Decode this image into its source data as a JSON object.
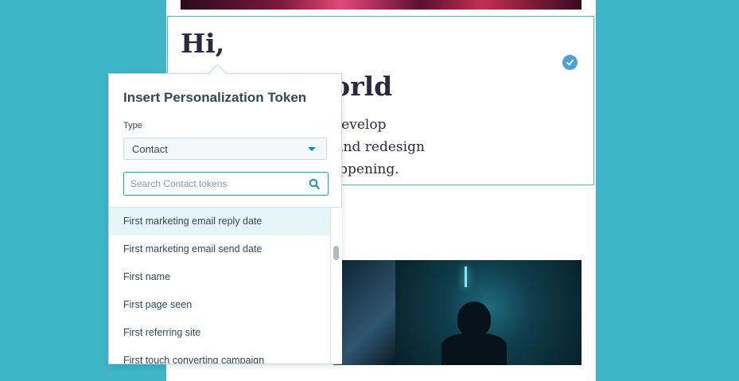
{
  "email": {
    "greeting": "Hi,",
    "headline": "over the world",
    "body_lines": [
      "ed that, once humans develop",
      "rill take off on its own and redesign",
      "g rate. And now, it’s happening."
    ]
  },
  "token_popover": {
    "title": "Insert Personalization Token",
    "type_label": "Type",
    "type_value": "Contact",
    "search_placeholder": "Search Contact tokens",
    "items": [
      "First marketing email reply date",
      "First marketing email send date",
      "First name",
      "First page seen",
      "First referring site",
      "First touch converting campaign"
    ],
    "active_index": 0
  },
  "colors": {
    "background": "#3eb5c9",
    "accent": "#00bda5",
    "selected_row": "#e5f5f8",
    "check_badge": "#4f9ee0"
  },
  "icons": {
    "check": "check-circle-icon",
    "select_caret": "caret-down-icon",
    "search": "search-icon"
  }
}
